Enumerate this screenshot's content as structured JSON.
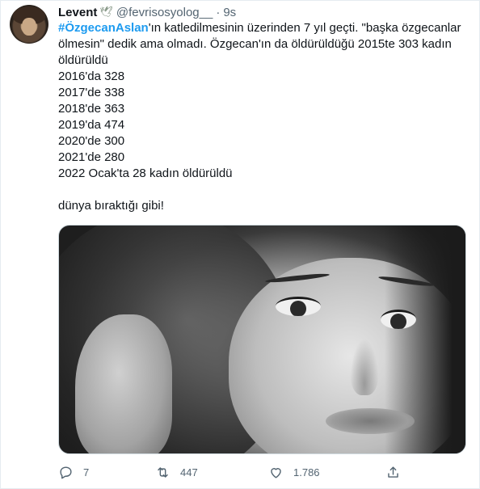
{
  "tweet": {
    "author_name": "Levent",
    "author_badge_icon": "dove-icon",
    "handle": "@fevrisosyolog__",
    "separator": "·",
    "time": "9s",
    "hashtag": "#ÖzgecanAslan",
    "line1_rest": "'ın katledilmesinin üzerinden 7 yıl geçti. \"başka özgecanlar",
    "line2": "ölmesin\" dedik ama olmadı. Özgecan'ın da öldürüldüğü 2015te 303 kadın",
    "line3": "öldürüldü",
    "years": [
      "2016'da 328",
      "2017'de 338",
      "2018'de 363",
      "2019'da 474",
      "2020'de 300",
      "2021'de 280",
      "2022 Ocak'ta 28 kadın öldürüldü"
    ],
    "closing": "dünya bıraktığı gibi!",
    "media_description_icon": "photo-portrait"
  },
  "actions": {
    "reply_count": "7",
    "retweet_count": "447",
    "like_count": "1.786",
    "share_label": ""
  },
  "colors": {
    "link": "#1d9bf0",
    "text": "#0f1419",
    "secondary": "#536471",
    "border": "#cfd9de"
  }
}
